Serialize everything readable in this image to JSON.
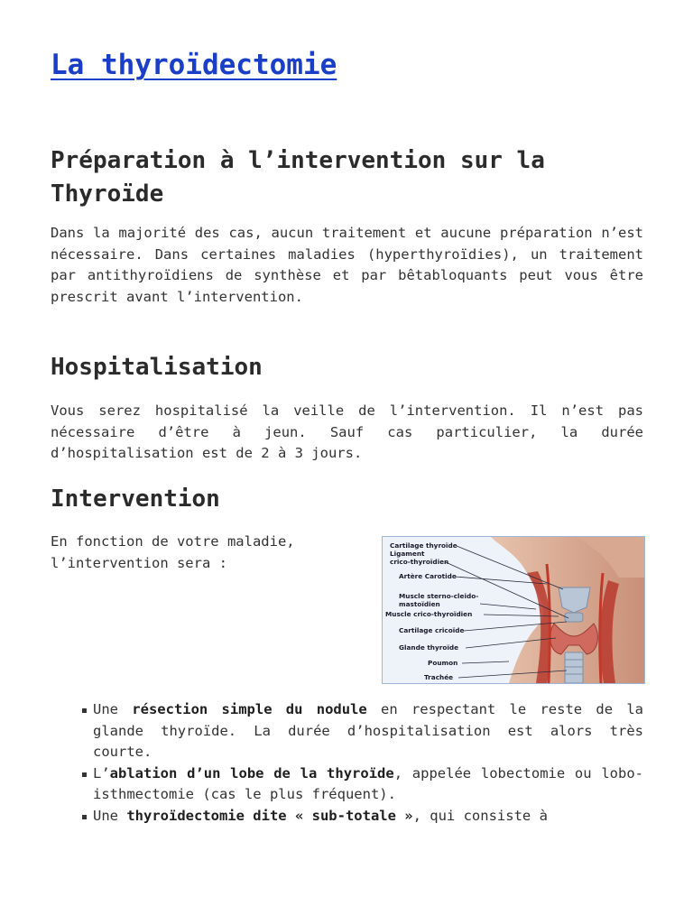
{
  "title": "La thyroïdectomie",
  "sections": {
    "preparation": {
      "heading": "Préparation à l’intervention sur la Thyroïde",
      "text": "Dans la majorité des cas, aucun traitement et aucune préparation n’est nécessaire. Dans certaines maladies (hyperthyroïdies), un traitement par antithyroïdiens de synthèse et par bêtabloquants peut vous être prescrit avant l’intervention."
    },
    "hospitalisation": {
      "heading": "Hospitalisation",
      "text": "Vous serez hospitalisé la veille de l’intervention. Il n’est pas nécessaire d’être à jeun. Sauf cas particulier, la durée d’hospitalisation est de 2 à 3 jours."
    },
    "intervention": {
      "heading": "Intervention",
      "intro_line1": "En fonction de votre maladie,",
      "intro_line2": "l’intervention sera :",
      "figure_labels": [
        "Cartilage thyroïde",
        "Ligament",
        "crico-thyroïdien",
        "Artère Carotide",
        "Muscle sterno-cleido-",
        "mastoïdien",
        "Muscle crico-thyroïdien",
        "Cartilage cricoïde",
        "Glande thyroïde",
        "Poumon",
        "Trachée"
      ],
      "bullets": [
        {
          "pre": "Une ",
          "bold": "résection simple du nodule",
          "post": " en respectant le reste de la glande thyroïde. La durée d’hospitalisation est alors très courte."
        },
        {
          "pre": "L’",
          "bold": "ablation d’un lobe de la thyroïde",
          "post": ", appelée lobectomie ou lobo-isthmectomie (cas le plus fréquent)."
        },
        {
          "pre": "Une ",
          "bold": "thyroïdectomie dite « sub-totale »",
          "post": ", qui consiste à"
        }
      ]
    }
  },
  "colors": {
    "title_link": "#1a3ec8",
    "text": "#333333",
    "figure_border": "#9fb6d8"
  }
}
